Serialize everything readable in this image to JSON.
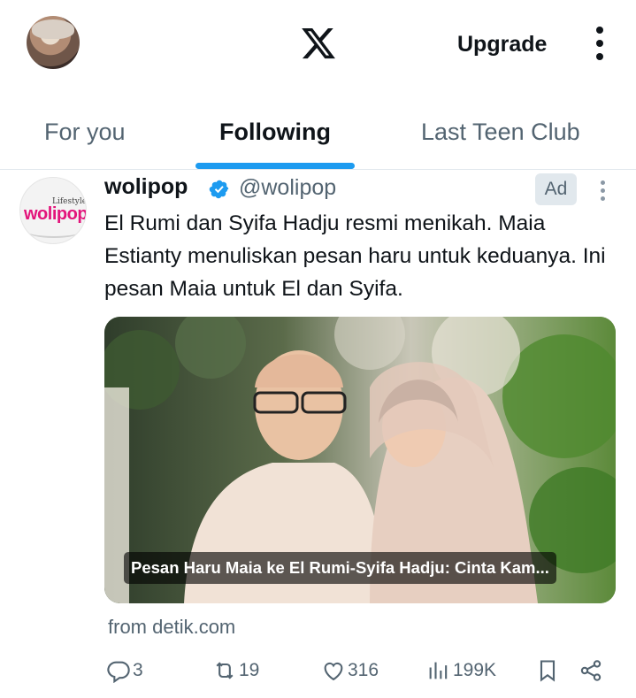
{
  "header": {
    "upgrade_label": "Upgrade"
  },
  "tabs": [
    {
      "label": "For you",
      "active": false
    },
    {
      "label": "Following",
      "active": true
    },
    {
      "label": "Last Teen Club",
      "active": false
    }
  ],
  "tweet": {
    "name": "wolipop",
    "handle": "@wolipop",
    "verified": true,
    "badge": "Ad",
    "text": "El Rumi dan Syifa Hadju resmi menikah. Maia Estianty menuliskan pesan haru untuk keduanya. Ini pesan Maia untuk El dan Syifa.",
    "media_caption": "Pesan Haru Maia ke El Rumi-Syifa Hadju: Cinta Kam...",
    "source": "from detik.com",
    "stats": {
      "replies": "3",
      "reposts": "19",
      "likes": "316",
      "views": "199K"
    }
  },
  "logo": {
    "wordmark_top": "Lifestyle",
    "wordmark": "wolipop"
  },
  "colors": {
    "accent": "#1d9bf0",
    "text_primary": "#0f1419",
    "text_secondary": "#536471",
    "brand_pink": "#e3147b"
  },
  "icons": [
    "x-logo-icon",
    "more-vertical-icon",
    "verified-badge-icon",
    "reply-icon",
    "repost-icon",
    "like-icon",
    "views-icon",
    "bookmark-icon",
    "share-icon"
  ]
}
